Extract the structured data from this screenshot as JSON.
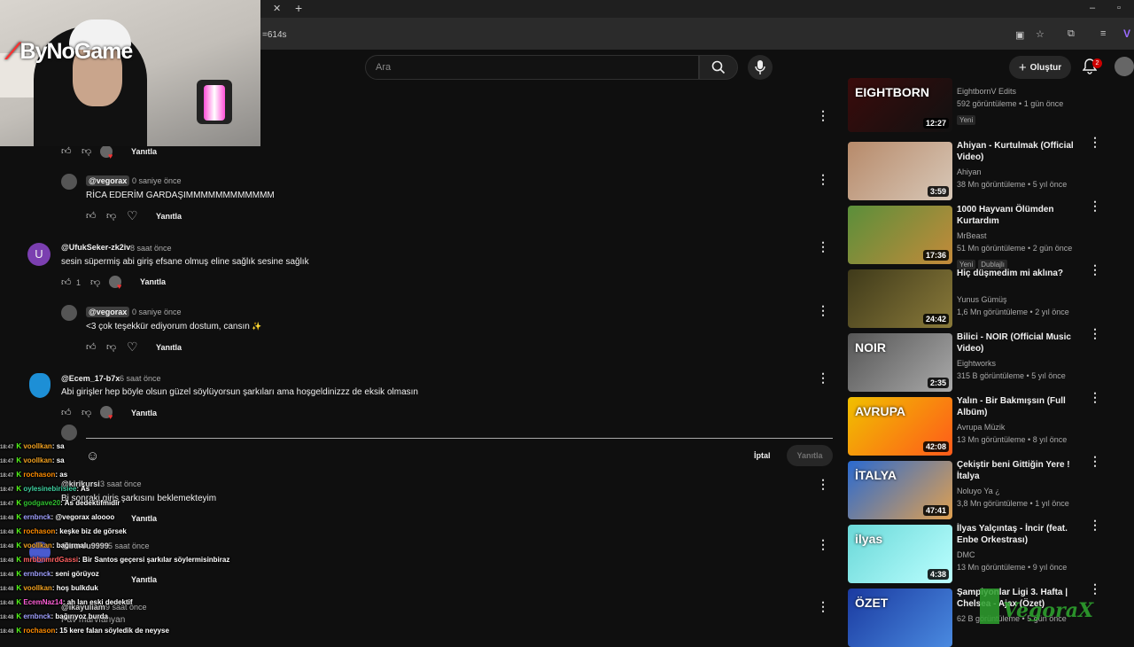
{
  "browser": {
    "url_fragment": "=614s",
    "tab_close": "✕",
    "tab_new": "+"
  },
  "header": {
    "search_placeholder": "Ara",
    "create_label": "Oluştur",
    "notif_count": "2"
  },
  "comments": [
    {
      "reply_label": "Yanıtla"
    },
    {
      "handle": "@vegorax",
      "time": "0 saniye önce",
      "text": "RİCA EDERİM GARDAŞIMMMMMMMMMMMM",
      "reply_label": "Yanıtla"
    },
    {
      "avatar_letter": "U",
      "handle": "@UfukSeker-zk2iv",
      "time": "8 saat önce",
      "text": "sesin süpermiş abi giriş efsane olmuş eline sağlık sesine sağlık",
      "likes": "1",
      "reply_label": "Yanıtla"
    },
    {
      "handle": "@vegorax",
      "time": "0 saniye önce",
      "text": "<3 çok teşekkür ediyorum dostum, cansın",
      "reply_label": "Yanıtla"
    },
    {
      "handle": "@Ecem_17-b7x",
      "time": "6 saat önce",
      "text": "Abi girişler hep böyle olsun güzel söylüyorsun şarkıları ama hoşgeldinizzz de eksik olmasın",
      "reply_label": "Yanıtla"
    }
  ],
  "reply_box": {
    "cancel": "İptal",
    "submit": "Yanıtla"
  },
  "more_comments": [
    {
      "handle": "@kirikursi",
      "time": "3 saat önce",
      "text": "Bi sonraki giriş şarkısını beklemekteyim",
      "reply_label": "Yanıtla"
    },
    {
      "handle": "@bursu9999",
      "time": "5 saat önce",
      "text": "Başarılar",
      "reply_label": "Yanıtla"
    },
    {
      "handle": "@ikayuliam",
      "time": "9 saat önce",
      "text": "Pav marvfanyan"
    }
  ],
  "sidebar": [
    {
      "title": "",
      "channel": "EightbornV Edits",
      "meta": "592 görüntüleme • 1 gün önce",
      "duration": "12:27",
      "new": "Yeni"
    },
    {
      "title": "Ahiyan - Kurtulmak (Official Video)",
      "channel": "Ahiyan",
      "meta": "38 Mn görüntüleme • 5 yıl önce",
      "duration": "3:59"
    },
    {
      "title": "1000 Hayvanı Ölümden Kurtardım",
      "channel": "MrBeast",
      "meta": "51 Mn görüntüleme • 2 gün önce",
      "duration": "17:36",
      "new": "Yeni",
      "dub": "Dublajlı"
    },
    {
      "title": "Hiç düşmedim mi aklına?",
      "channel": "Yunus Gümüş",
      "meta": "1,6 Mn görüntüleme • 2 yıl önce",
      "duration": "24:42"
    },
    {
      "title": "Bilici - NOIR (Official Music Video)",
      "channel": "Eightworks",
      "meta": "315 B görüntüleme • 5 yıl önce",
      "duration": "2:35"
    },
    {
      "title": "Yalın - Bir Bakmışsın (Full Albüm)",
      "channel": "Avrupa Müzik",
      "meta": "13 Mn görüntüleme • 8 yıl önce",
      "duration": "42:08"
    },
    {
      "title": "Çekiştir beni Gittiğin Yere ! İtalya",
      "channel": "Noluyo Ya ¿",
      "meta": "3,8 Mn görüntüleme • 1 yıl önce",
      "duration": "47:41"
    },
    {
      "title": "İlyas Yalçıntaş - İncir (feat. Enbe Orkestrası)",
      "channel": "DMC",
      "meta": "13 Mn görüntüleme • 9 yıl önce",
      "duration": "4:38"
    },
    {
      "title": "Şampiyonlar Ligi 3. Hafta | Chelsea - Ajax (Özet)",
      "channel": "",
      "meta": "62 B görüntüleme • 5 gün önce",
      "duration": ""
    }
  ],
  "thumb_text": {
    "t0": "EIGHTBORN",
    "t4": "NOIR",
    "t5": "AVRUPA",
    "t6": "İTALYA",
    "t7": "ilyas",
    "t8": "ÖZET"
  },
  "overlay": {
    "brand": "ByNoGame",
    "watermark": "VegoraX"
  },
  "chat": [
    {
      "ts": "18:47",
      "user": "voollkan",
      "msg": ": sa",
      "color": "#f0a020"
    },
    {
      "ts": "18:47",
      "user": "voollkan",
      "msg": ": sa",
      "color": "#f0a020"
    },
    {
      "ts": "18:47",
      "user": "rochason",
      "msg": ": as",
      "color": "#ff8c00"
    },
    {
      "ts": "18:47",
      "user": "oylesinebirisiee",
      "msg": ": As",
      "color": "#3fd0a0"
    },
    {
      "ts": "18:47",
      "user": "godgave20",
      "msg": ": As dedektifmidir",
      "color": "#30c030"
    },
    {
      "ts": "18:48",
      "user": "ernbnck",
      "msg": ": @vegorax aloooo",
      "color": "#a0a0ff"
    },
    {
      "ts": "18:48",
      "user": "rochason",
      "msg": ": keşke biz de görsek",
      "color": "#ff8c00"
    },
    {
      "ts": "18:48",
      "user": "voollkan",
      "msg": ": bağırmalı",
      "color": "#f0a020"
    },
    {
      "ts": "18:48",
      "user": "mrbbnmrdGassi",
      "msg": ": Bir Santos geçersi şarkılar söylermisinbiraz",
      "color": "#ff6060"
    },
    {
      "ts": "18:48",
      "user": "ernbnck",
      "msg": ": seni görüyoz",
      "color": "#a0a0ff"
    },
    {
      "ts": "18:48",
      "user": "voollkan",
      "msg": ": hoş bulkduk",
      "color": "#f0a020"
    },
    {
      "ts": "18:48",
      "user": "EcemNaz14",
      "msg": ": ah lan eski dedektif",
      "color": "#ff5fd7"
    },
    {
      "ts": "18:48",
      "user": "ernbnck",
      "msg": ": bağırıyoz burda",
      "color": "#a0a0ff"
    },
    {
      "ts": "18:48",
      "user": "rochason",
      "msg": ": 15 kere falan söyledik de neyyse",
      "color": "#ff8c00"
    }
  ]
}
